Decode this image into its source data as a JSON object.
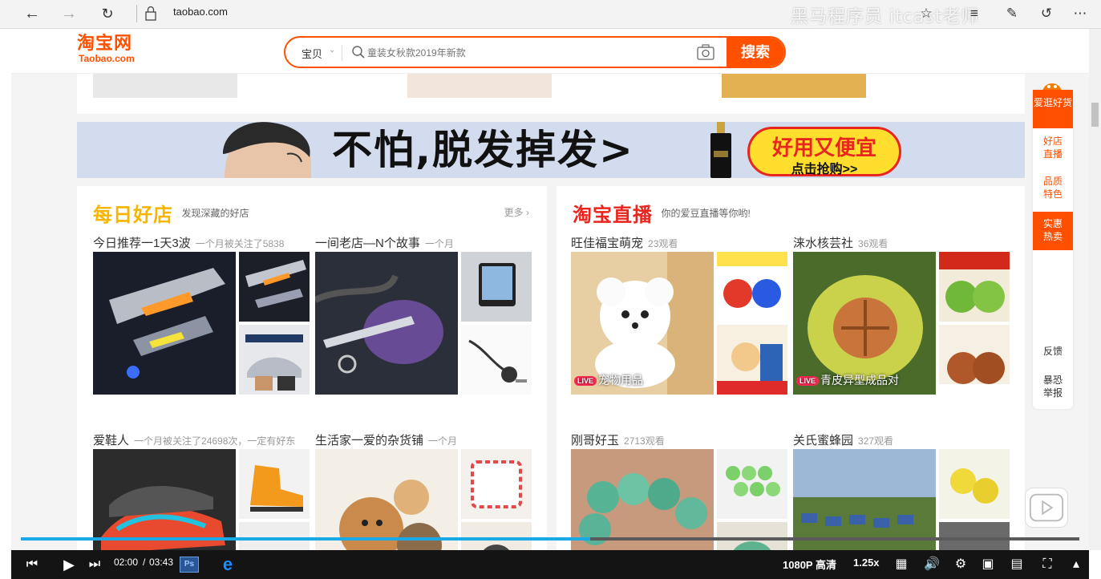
{
  "browser": {
    "url": "taobao.com",
    "watermark": "黑马程序员 itcast老师"
  },
  "header": {
    "logo_cn": "淘宝网",
    "logo_en": "Taobao.com",
    "search_category": "宝贝",
    "search_placeholder": "童装女秋款2019年新款",
    "search_button": "搜索"
  },
  "banner": {
    "headline": "不怕,脱发掉发>",
    "cta_main": "好用又便宜",
    "cta_sub": "点击抢购>>"
  },
  "good_shops": {
    "title": "每日好店",
    "subtitle": "发现深藏的好店",
    "more": "更多",
    "cards": [
      {
        "title": "今日推荐一1天3波",
        "sub": "一个月被关注了5838"
      },
      {
        "title": "一间老店—N个故事",
        "sub": "一个月"
      },
      {
        "title": "爱鞋人",
        "sub": "一个月被关注了24698次，一定有好东"
      },
      {
        "title": "生活家一爱的杂货铺",
        "sub": "一个月"
      }
    ]
  },
  "live": {
    "title": "淘宝直播",
    "subtitle": "你的爱豆直播等你哟!",
    "cards": [
      {
        "title": "旺佳福宝萌宠",
        "sub": "23观看",
        "badge": "宠物用品"
      },
      {
        "title": "涞水核芸社",
        "sub": "36观看",
        "badge": "青皮异型成品对"
      },
      {
        "title": "刚哥好玉",
        "sub": "2713观看",
        "badge": ""
      },
      {
        "title": "关氏蜜蜂园",
        "sub": "327观看",
        "badge": ""
      }
    ],
    "live_tag": "LIVE"
  },
  "sidebar": {
    "items": [
      {
        "label": "爱逛好货",
        "style": "hot"
      },
      {
        "label": "好店直播",
        "style": "text"
      },
      {
        "label": "品质特色",
        "style": "text"
      },
      {
        "label": "实惠热卖",
        "style": "hot"
      },
      {
        "label": "反馈",
        "style": "gray"
      },
      {
        "label": "暴恐举报",
        "style": "gray"
      }
    ]
  },
  "player": {
    "time_current": "02:00",
    "time_separator": "/",
    "time_total": "03:43",
    "progress": 0.538,
    "quality": "1080P 高清",
    "speed": "1.25x",
    "ps_label": "Ps"
  }
}
